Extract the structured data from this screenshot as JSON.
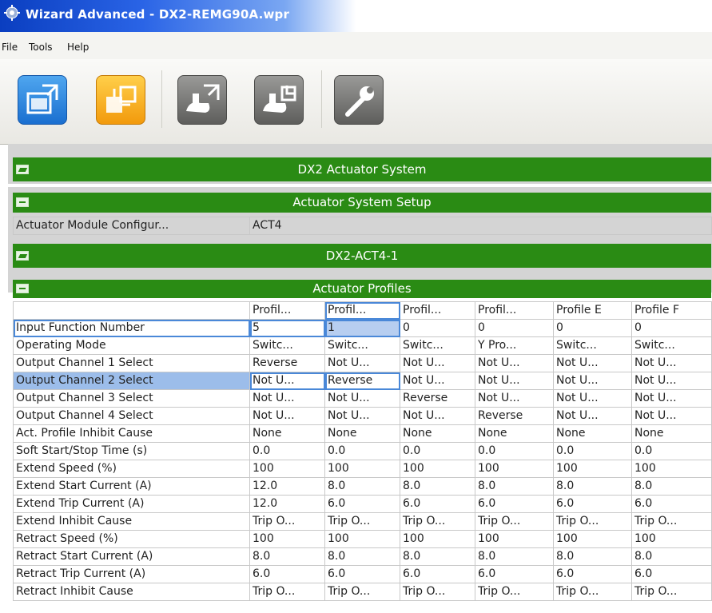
{
  "window": {
    "title": "Wizard Advanced - DX2-REMG90A.wpr"
  },
  "menu": {
    "file": "File",
    "tools": "Tools",
    "help": "Help"
  },
  "toolbar": {
    "buttons": [
      {
        "icon": "window-restore-blue-icon"
      },
      {
        "icon": "window-cascade-yellow-icon"
      },
      {
        "icon": "actuator-extend-icon"
      },
      {
        "icon": "actuator-retract-icon"
      },
      {
        "icon": "wrench-icon"
      }
    ]
  },
  "colors": {
    "header_green": "#2a8b14",
    "selection_blue": "#9cbdea"
  },
  "sections": {
    "dx2_actuator_system": "DX2 Actuator System",
    "actuator_system_setup": "Actuator System Setup",
    "dx2_act4_1": "DX2-ACT4-1",
    "actuator_profiles": "Actuator Profiles"
  },
  "setup": {
    "label": "Actuator Module Configur...",
    "value": "ACT4"
  },
  "profiles": {
    "columns": [
      "Profil...",
      "Profil...",
      "Profil...",
      "Profil...",
      "Profile E",
      "Profile F"
    ],
    "rows": [
      {
        "label": "Input Function Number",
        "values": [
          "5",
          "1",
          "0",
          "0",
          "0",
          "0"
        ]
      },
      {
        "label": "Operating Mode",
        "values": [
          "Switc...",
          "Switc...",
          "Switc...",
          "Y Pro...",
          "Switc...",
          "Switc..."
        ]
      },
      {
        "label": "Output Channel 1 Select",
        "values": [
          "Reverse",
          "Not U...",
          "Not U...",
          "Not U...",
          "Not U...",
          "Not U..."
        ]
      },
      {
        "label": "Output Channel 2 Select",
        "values": [
          "Not U...",
          "Reverse",
          "Not U...",
          "Not U...",
          "Not U...",
          "Not U..."
        ]
      },
      {
        "label": "Output Channel 3 Select",
        "values": [
          "Not U...",
          "Not U...",
          "Reverse",
          "Not U...",
          "Not U...",
          "Not U..."
        ]
      },
      {
        "label": "Output Channel 4 Select",
        "values": [
          "Not U...",
          "Not U...",
          "Not U...",
          "Reverse",
          "Not U...",
          "Not U..."
        ]
      },
      {
        "label": "Act. Profile Inhibit Cause",
        "values": [
          "None",
          "None",
          "None",
          "None",
          "None",
          "None"
        ]
      },
      {
        "label": "Soft Start/Stop Time (s)",
        "values": [
          "0.0",
          "0.0",
          "0.0",
          "0.0",
          "0.0",
          "0.0"
        ]
      },
      {
        "label": "Extend Speed (%)",
        "values": [
          "100",
          "100",
          "100",
          "100",
          "100",
          "100"
        ]
      },
      {
        "label": "Extend Start Current (A)",
        "values": [
          "12.0",
          "8.0",
          "8.0",
          "8.0",
          "8.0",
          "8.0"
        ]
      },
      {
        "label": "Extend Trip Current (A)",
        "values": [
          "12.0",
          "6.0",
          "6.0",
          "6.0",
          "6.0",
          "6.0"
        ]
      },
      {
        "label": "Extend Inhibit Cause",
        "values": [
          "Trip O...",
          "Trip O...",
          "Trip O...",
          "Trip O...",
          "Trip O...",
          "Trip O..."
        ]
      },
      {
        "label": "Retract Speed (%)",
        "values": [
          "100",
          "100",
          "100",
          "100",
          "100",
          "100"
        ]
      },
      {
        "label": "Retract Start Current (A)",
        "values": [
          "8.0",
          "8.0",
          "8.0",
          "8.0",
          "8.0",
          "8.0"
        ]
      },
      {
        "label": "Retract Trip Current (A)",
        "values": [
          "6.0",
          "6.0",
          "6.0",
          "6.0",
          "6.0",
          "6.0"
        ]
      },
      {
        "label": "Retract Inhibit Cause",
        "values": [
          "Trip O...",
          "Trip O...",
          "Trip O...",
          "Trip O...",
          "Trip O...",
          "Trip O..."
        ]
      }
    ]
  }
}
